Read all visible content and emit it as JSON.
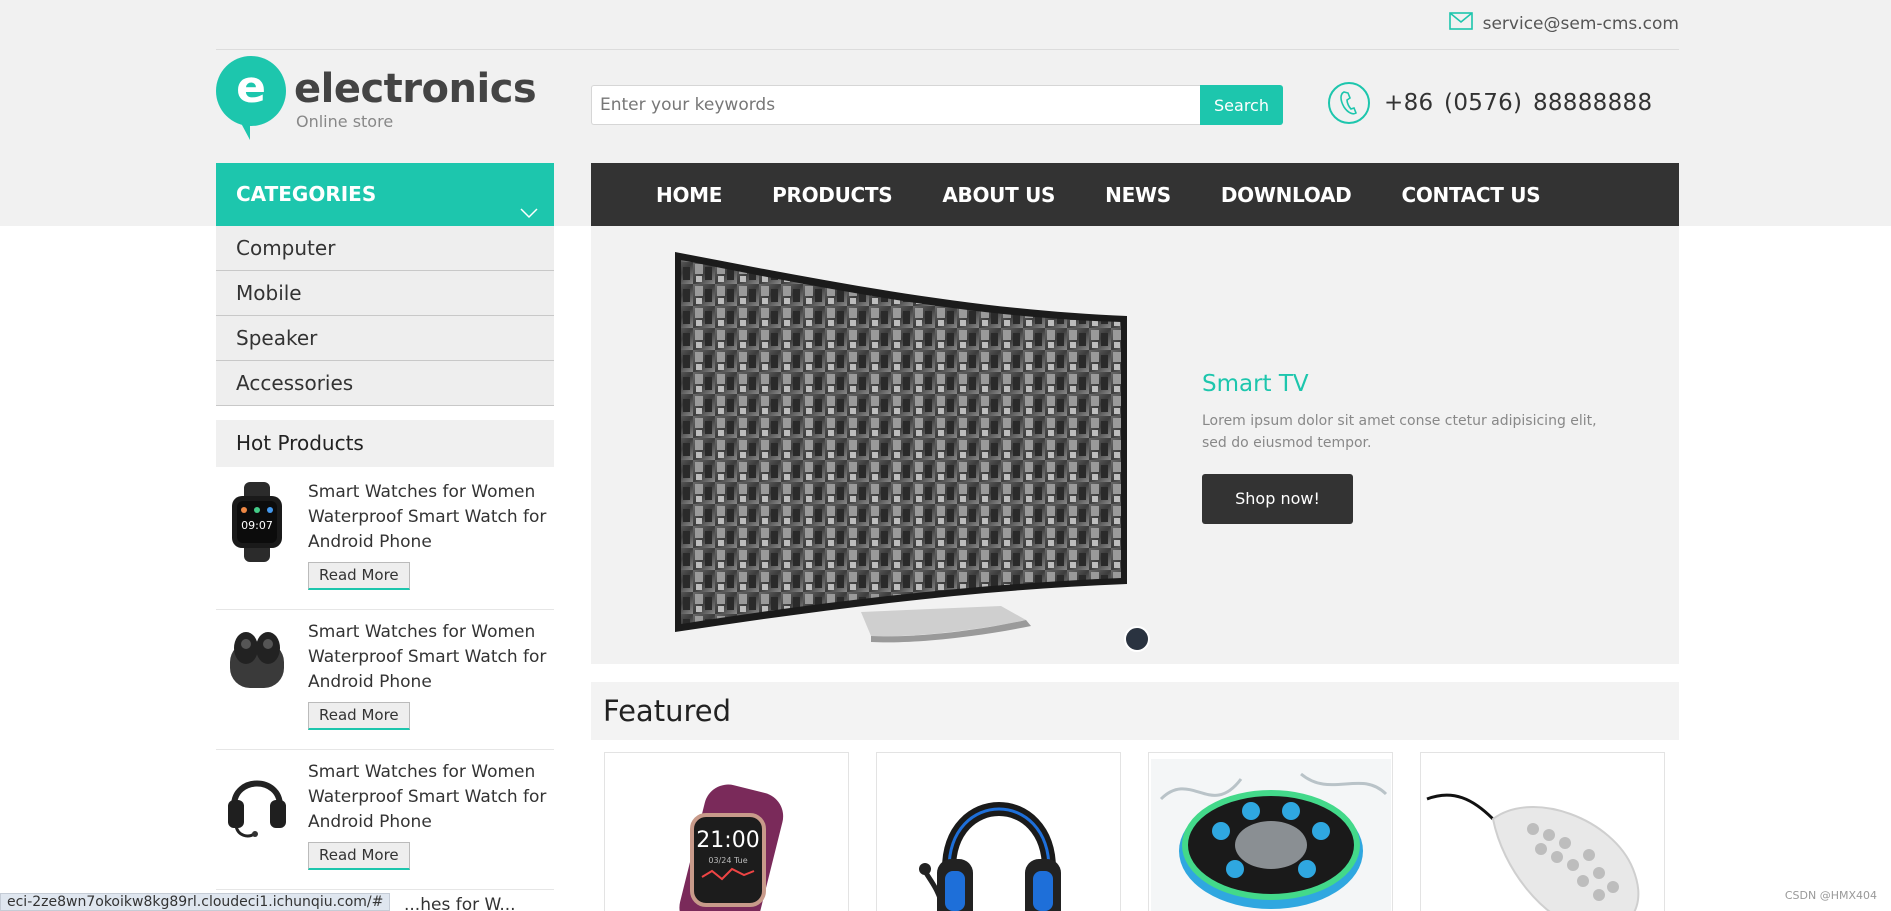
{
  "header": {
    "email": "service@sem-cms.com",
    "phone": "+86  (0576)  88888888",
    "logo_letter": "e",
    "logo_title": "electronics",
    "logo_subtitle": "Online store",
    "accent_color": "#1dc6ad"
  },
  "search": {
    "placeholder": "Enter your keywords",
    "value": "",
    "button_label": "Search"
  },
  "nav": {
    "items": [
      "HOME",
      "PRODUCTS",
      "ABOUT US",
      "NEWS",
      "DOWNLOAD",
      "CONTACT US"
    ]
  },
  "sidebar": {
    "categories_label": "CATEGORIES",
    "categories": [
      "Computer",
      "Mobile",
      "Speaker",
      "Accessories"
    ],
    "hot_label": "Hot Products",
    "hot_products": [
      {
        "title": "Smart Watches for Women Waterproof Smart Watch for Android Phone",
        "button": "Read More",
        "icon": "smartwatch-icon"
      },
      {
        "title": "Smart Watches for Women Waterproof Smart Watch for Android Phone",
        "button": "Read More",
        "icon": "earbuds-icon"
      },
      {
        "title": "Smart Watches for Women Waterproof Smart Watch for Android Phone",
        "button": "Read More",
        "icon": "headphones-icon"
      }
    ]
  },
  "slider": {
    "title": "Smart TV",
    "description": "Lorem ipsum dolor sit amet conse ctetur adipisicing elit, sed do eiusmod tempor.",
    "button": "Shop now!"
  },
  "featured": {
    "heading": "Featured",
    "products": [
      "smartwatch",
      "gaming-headset",
      "bluetooth-speaker",
      "gaming-mouse"
    ]
  },
  "status": {
    "url": "eci-2ze8wn7okoikw8kg89rl.cloudeci1.ichunqiu.com/#",
    "trailing_text": "...hes for W..."
  },
  "watermark": "CSDN @HMX404"
}
